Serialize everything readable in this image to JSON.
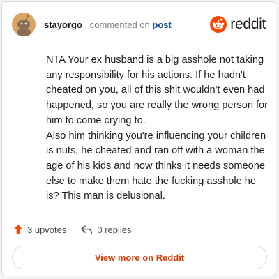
{
  "comment": {
    "username": "stayorgo_",
    "action_text": "commented on",
    "post_link": "post",
    "paragraphs": [
      "NTA Your ex husband is a big asshole not taking any responsibility for his actions. If he hadn't cheated on you, all of this shit wouldn't even had happened, so you are really the wrong person for him to come crying to.",
      "Also him thinking you're influencing your children is nuts, he cheated and ran off with a woman the age of his kids and now thinks it needs someone else to make them hate the fucking asshole he is? This man is delusional."
    ],
    "upvotes_label": "3 upvotes",
    "replies_label": "0 replies"
  },
  "brand": {
    "name": "reddit",
    "icon": "reddit-logo-icon",
    "color": "#ff4500"
  },
  "cta": {
    "label": "View more on Reddit",
    "color": "#d93a00"
  },
  "icons": {
    "upvote": "upvote-arrow-icon",
    "reply": "reply-arrow-icon",
    "avatar": "avatar-snoo-icon"
  }
}
